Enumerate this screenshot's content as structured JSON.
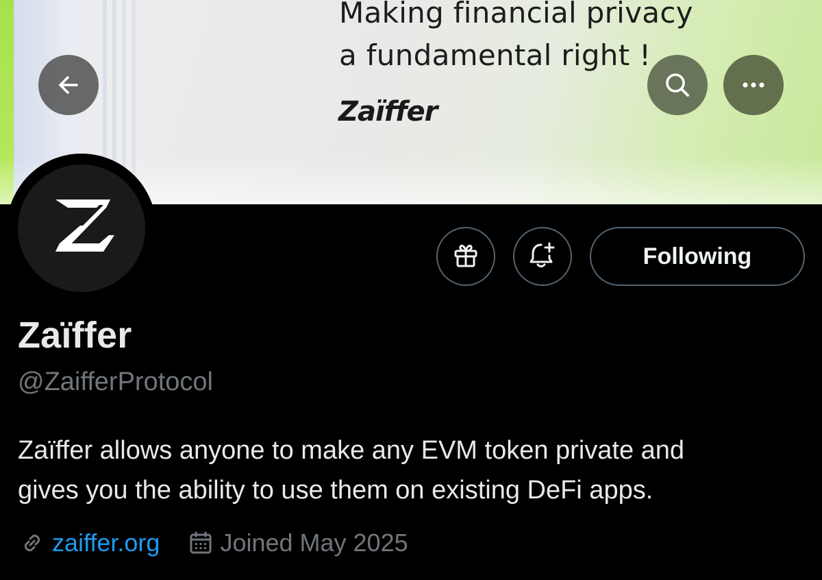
{
  "banner": {
    "headline": "Making financial privacy\na fundamental right !",
    "logo_text": "Zaïffer"
  },
  "nav": {
    "back_icon": "arrow-left-icon",
    "search_icon": "search-icon",
    "more_icon": "more-horizontal-icon"
  },
  "avatar": {
    "logo_text": "Z"
  },
  "actions": {
    "gift_icon": "gift-icon",
    "notify_icon": "bell-plus-icon",
    "follow_label": "Following"
  },
  "profile": {
    "display_name": "Zaïffer",
    "handle": "@ZaifferProtocol",
    "bio": "Zaïffer allows anyone to make any EVM token private and\ngives you the ability to use them on existing DeFi apps.",
    "website": "zaiffer.org",
    "joined": "Joined May 2025"
  },
  "colors": {
    "background": "#000000",
    "text_primary": "#e7e9ea",
    "text_secondary": "#71767b",
    "link": "#1d9bf0",
    "border": "#536471",
    "banner_green": "#a6e14d"
  }
}
